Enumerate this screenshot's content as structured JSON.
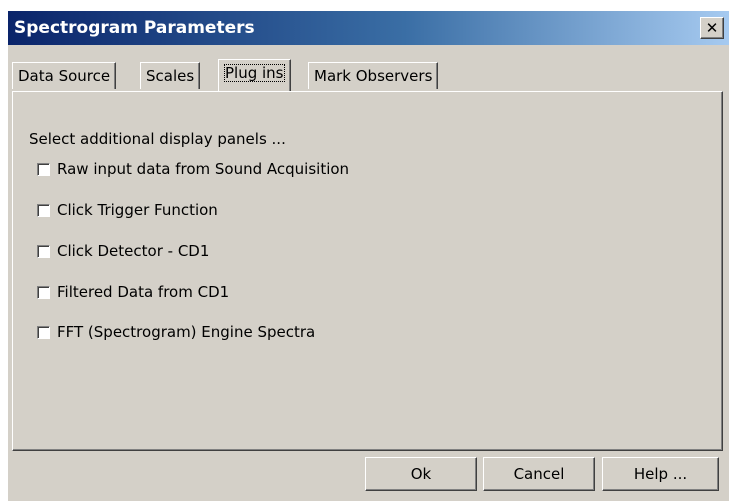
{
  "window": {
    "title": "Spectrogram Parameters",
    "close_glyph": "✕"
  },
  "tabs": [
    {
      "label": "Data Source",
      "active": false
    },
    {
      "label": "Scales",
      "active": false
    },
    {
      "label": "Plug ins",
      "active": true
    },
    {
      "label": "Mark Observers",
      "active": false
    }
  ],
  "panel": {
    "prompt": "Select additional display panels ...",
    "options": [
      {
        "label": "Raw input data from Sound Acquisition",
        "checked": false
      },
      {
        "label": "Click Trigger Function",
        "checked": false
      },
      {
        "label": "Click Detector - CD1",
        "checked": false
      },
      {
        "label": "Filtered Data from CD1",
        "checked": false
      },
      {
        "label": "FFT (Spectrogram) Engine Spectra",
        "checked": false
      }
    ]
  },
  "buttons": {
    "ok": "Ok",
    "cancel": "Cancel",
    "help": "Help ..."
  },
  "colors": {
    "title_start": "#0a246a",
    "title_end": "#a6caf0",
    "face": "#d4d0c8"
  }
}
